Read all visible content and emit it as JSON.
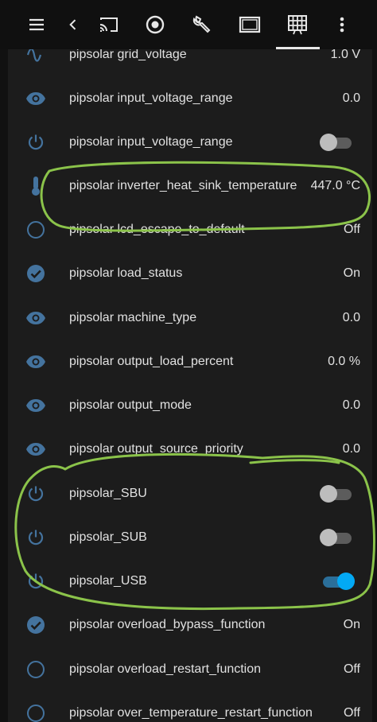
{
  "colors": {
    "icon": "#44739e",
    "toggle_on": "#03a9f4",
    "annotation": "#8bc34a"
  },
  "toolbar": {
    "icons": [
      "menu-icon",
      "back-icon",
      "cast-icon",
      "history-icon",
      "wrench-icon",
      "tablet-icon",
      "grid-icon",
      "more-vert-icon"
    ]
  },
  "rows": [
    {
      "label": "pipsolar grid_voltage",
      "value": "1.0 V",
      "icon": "sine-wave-icon"
    },
    {
      "label": "pipsolar input_voltage_range",
      "value": "0.0",
      "icon": "eye-icon"
    },
    {
      "label": "pipsolar input_voltage_range",
      "value": "",
      "icon": "power-icon",
      "toggle": "off"
    },
    {
      "label": "pipsolar inverter_heat_sink_temperature",
      "value": "447.0 °C",
      "icon": "thermometer-icon"
    },
    {
      "label": "pipsolar lcd_escape_to_default",
      "value": "Off",
      "icon": "circle-outline-icon"
    },
    {
      "label": "pipsolar load_status",
      "value": "On",
      "icon": "check-circle-icon"
    },
    {
      "label": "pipsolar machine_type",
      "value": "0.0",
      "icon": "eye-icon"
    },
    {
      "label": "pipsolar output_load_percent",
      "value": "0.0 %",
      "icon": "eye-icon"
    },
    {
      "label": "pipsolar output_mode",
      "value": "0.0",
      "icon": "eye-icon"
    },
    {
      "label": "pipsolar output_source_priority",
      "value": "0.0",
      "icon": "eye-icon"
    },
    {
      "label": "pipsolar_SBU",
      "value": "",
      "icon": "power-icon",
      "toggle": "off"
    },
    {
      "label": "pipsolar_SUB",
      "value": "",
      "icon": "power-icon",
      "toggle": "off"
    },
    {
      "label": "pipsolar_USB",
      "value": "",
      "icon": "power-icon",
      "toggle": "on"
    },
    {
      "label": "pipsolar overload_bypass_function",
      "value": "On",
      "icon": "check-circle-icon"
    },
    {
      "label": "pipsolar overload_restart_function",
      "value": "Off",
      "icon": "circle-outline-icon"
    },
    {
      "label": "pipsolar over_temperature_restart_function",
      "value": "Off",
      "icon": "circle-outline-icon"
    }
  ]
}
